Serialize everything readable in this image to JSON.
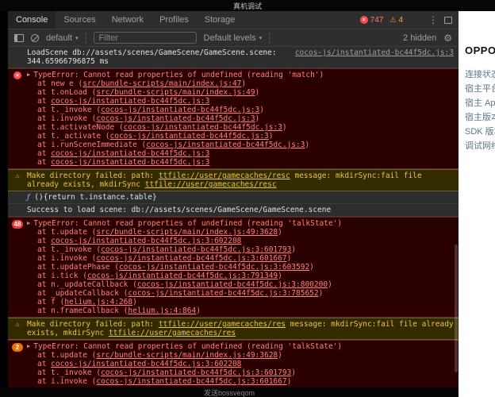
{
  "window": {
    "title": "真机调试",
    "bottom_text": "发送bossveqom"
  },
  "icons": {
    "error_glyph": "×",
    "warning_glyph": "⚠",
    "caret_down": "▾",
    "expand_caret": "▶",
    "kebab": "⋮",
    "gear": "⚙"
  },
  "colors": {
    "error_text": "#ff8080",
    "error_bg": "#2b0000",
    "warning_text": "#e9c34c",
    "warning_bg": "#332b00",
    "badge_red": "#f23b3b",
    "badge_orange": "#e8710a"
  },
  "devtools": {
    "tabs": [
      {
        "label": "Console",
        "active": true
      },
      {
        "label": "Sources",
        "active": false
      },
      {
        "label": "Network",
        "active": false
      },
      {
        "label": "Profiles",
        "active": false
      },
      {
        "label": "Storage",
        "active": false
      }
    ],
    "error_count": "747",
    "warning_count": "4",
    "toolbar": {
      "context_selector": "default",
      "filter_placeholder": "Filter",
      "levels_selector": "Default levels",
      "hidden_label": "2 hidden"
    }
  },
  "sidebar": {
    "title": "OPPO",
    "items": [
      "连接状态",
      "宿主平台",
      "宿主 Ap",
      "宿主版本",
      "SDK 版本",
      "调试网络"
    ]
  },
  "console": {
    "messages": [
      {
        "type": "log",
        "source_link": "cocos-js/instantiated-bc44f5dc.js:3",
        "main": [
          {
            "t": "text",
            "v": "LoadScene db://assets/scenes/GameScene/GameScene.scene: 344.65966796875 ms"
          }
        ]
      },
      {
        "type": "error",
        "expandable": true,
        "main": [
          {
            "t": "text",
            "v": "TypeError: Cannot read properties of undefined (reading 'match')"
          }
        ],
        "stack": [
          [
            {
              "t": "text",
              "v": "at new e ("
            },
            {
              "t": "link",
              "v": "src/bundle-scripts/main/index.js:47"
            },
            {
              "t": "text",
              "v": ")"
            }
          ],
          [
            {
              "t": "text",
              "v": "at t.onLoad ("
            },
            {
              "t": "link",
              "v": "src/bundle-scripts/main/index.js:49"
            },
            {
              "t": "text",
              "v": ")"
            }
          ],
          [
            {
              "t": "text",
              "v": "at "
            },
            {
              "t": "link",
              "v": "cocos-js/instantiated-bc44f5dc.js:3"
            }
          ],
          [
            {
              "t": "text",
              "v": "at t._invoke ("
            },
            {
              "t": "link",
              "v": "cocos-js/instantiated-bc44f5dc.js:3"
            },
            {
              "t": "text",
              "v": ")"
            }
          ],
          [
            {
              "t": "text",
              "v": "at i.invoke ("
            },
            {
              "t": "link",
              "v": "cocos-js/instantiated-bc44f5dc.js:3"
            },
            {
              "t": "text",
              "v": ")"
            }
          ],
          [
            {
              "t": "text",
              "v": "at t.activateNode ("
            },
            {
              "t": "link",
              "v": "cocos-js/instantiated-bc44f5dc.js:3"
            },
            {
              "t": "text",
              "v": ")"
            }
          ],
          [
            {
              "t": "text",
              "v": "at t._activate ("
            },
            {
              "t": "link",
              "v": "cocos-js/instantiated-bc44f5dc.js:3"
            },
            {
              "t": "text",
              "v": ")"
            }
          ],
          [
            {
              "t": "text",
              "v": "at i.runSceneImmediate ("
            },
            {
              "t": "link",
              "v": "cocos-js/instantiated-bc44f5dc.js:3"
            },
            {
              "t": "text",
              "v": ")"
            }
          ],
          [
            {
              "t": "text",
              "v": "at "
            },
            {
              "t": "link",
              "v": "cocos-js/instantiated-bc44f5dc.js:3"
            }
          ],
          [
            {
              "t": "text",
              "v": "at "
            },
            {
              "t": "link",
              "v": "cocos-js/instantiated-bc44f5dc.js:3"
            }
          ]
        ]
      },
      {
        "type": "warning",
        "main": [
          {
            "t": "text",
            "v": "Make directory failed: path: "
          },
          {
            "t": "link",
            "v": "ttfile://user/gamecaches/resc"
          },
          {
            "t": "text",
            "v": " message: mkdirSync:fail file already exists, mkdirSync "
          },
          {
            "t": "link",
            "v": "ttfile://user/gamecaches/resc"
          }
        ]
      },
      {
        "type": "log",
        "main": [
          {
            "t": "fn",
            "v": "ƒ"
          },
          {
            "t": "text",
            "v": " (){return t.instance.table}"
          }
        ]
      },
      {
        "type": "log",
        "main": [
          {
            "t": "text",
            "v": "Success to load scene: db://assets/scenes/GameScene/GameScene.scene"
          }
        ]
      },
      {
        "type": "error",
        "expandable": true,
        "badge": "48",
        "badge_color": "#f23b3b",
        "main": [
          {
            "t": "text",
            "v": "TypeError: Cannot read properties of undefined (reading 'talkState')"
          }
        ],
        "stack": [
          [
            {
              "t": "text",
              "v": "at t.update ("
            },
            {
              "t": "link",
              "v": "src/bundle-scripts/main/index.js:49:3628"
            },
            {
              "t": "text",
              "v": ")"
            }
          ],
          [
            {
              "t": "text",
              "v": "at "
            },
            {
              "t": "link",
              "v": "cocos-js/instantiated-bc44f5dc.js:3:602208"
            }
          ],
          [
            {
              "t": "text",
              "v": "at t._invoke ("
            },
            {
              "t": "link",
              "v": "cocos-js/instantiated-bc44f5dc.js:3:601793"
            },
            {
              "t": "text",
              "v": ")"
            }
          ],
          [
            {
              "t": "text",
              "v": "at i.invoke ("
            },
            {
              "t": "link",
              "v": "cocos-js/instantiated-bc44f5dc.js:3:601667"
            },
            {
              "t": "text",
              "v": ")"
            }
          ],
          [
            {
              "t": "text",
              "v": "at t.updatePhase ("
            },
            {
              "t": "link",
              "v": "cocos-js/instantiated-bc44f5dc.js:3:603592"
            },
            {
              "t": "text",
              "v": ")"
            }
          ],
          [
            {
              "t": "text",
              "v": "at i.tick ("
            },
            {
              "t": "link",
              "v": "cocos-js/instantiated-bc44f5dc.js:3:791349"
            },
            {
              "t": "text",
              "v": ")"
            }
          ],
          [
            {
              "t": "text",
              "v": "at n._updateCallback ("
            },
            {
              "t": "link",
              "v": "cocos-js/instantiated-bc44f5dc.js:3:800200"
            },
            {
              "t": "text",
              "v": ")"
            }
          ],
          [
            {
              "t": "text",
              "v": "at _updateCallback ("
            },
            {
              "t": "link",
              "v": "cocos-js/instantiated-bc44f5dc.js:3:785652"
            },
            {
              "t": "text",
              "v": ")"
            }
          ],
          [
            {
              "t": "text",
              "v": "at f ("
            },
            {
              "t": "link",
              "v": "helium.js:4:268"
            },
            {
              "t": "text",
              "v": ")"
            }
          ],
          [
            {
              "t": "text",
              "v": "at n.frameCallback ("
            },
            {
              "t": "link",
              "v": "helium.js:4:864"
            },
            {
              "t": "text",
              "v": ")"
            }
          ]
        ]
      },
      {
        "type": "warning",
        "main": [
          {
            "t": "text",
            "v": "Make directory failed: path: "
          },
          {
            "t": "link",
            "v": "ttfile://user/gamecaches/res"
          },
          {
            "t": "text",
            "v": " message: mkdirSync:fail file already exists, mkdirSync "
          },
          {
            "t": "link",
            "v": "ttfile://user/gamecaches/res"
          }
        ]
      },
      {
        "type": "error",
        "expandable": true,
        "badge": "2",
        "badge_color": "#e8710a",
        "main": [
          {
            "t": "text",
            "v": "TypeError: Cannot read properties of undefined (reading 'talkState')"
          }
        ],
        "stack": [
          [
            {
              "t": "text",
              "v": "at t.update ("
            },
            {
              "t": "link",
              "v": "src/bundle-scripts/main/index.js:49:3628"
            },
            {
              "t": "text",
              "v": ")"
            }
          ],
          [
            {
              "t": "text",
              "v": "at "
            },
            {
              "t": "link",
              "v": "cocos-js/instantiated-bc44f5dc.js:3:602208"
            }
          ],
          [
            {
              "t": "text",
              "v": "at t._invoke ("
            },
            {
              "t": "link",
              "v": "cocos-js/instantiated-bc44f5dc.js:3:601793"
            },
            {
              "t": "text",
              "v": ")"
            }
          ],
          [
            {
              "t": "text",
              "v": "at i.invoke ("
            },
            {
              "t": "link",
              "v": "cocos-js/instantiated-bc44f5dc.js:3:601667"
            },
            {
              "t": "text",
              "v": ")"
            }
          ]
        ]
      }
    ]
  }
}
